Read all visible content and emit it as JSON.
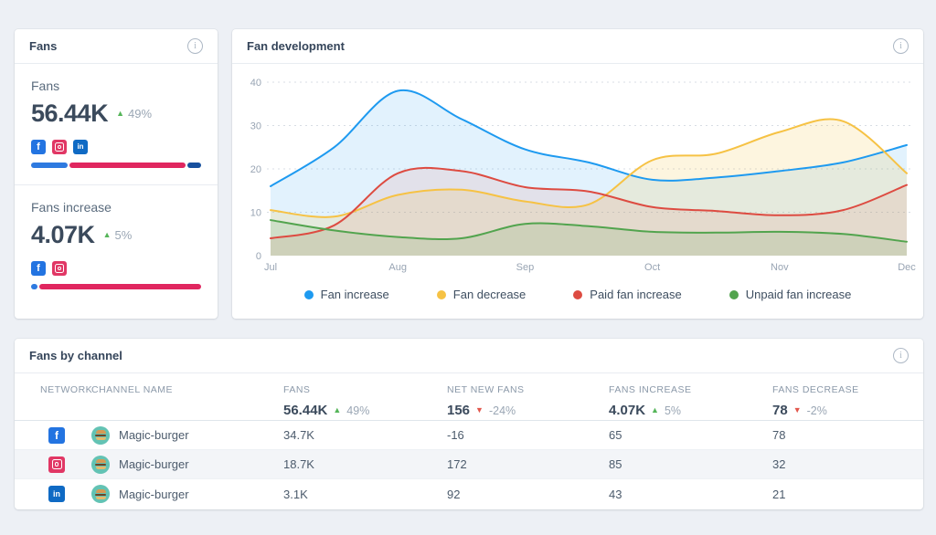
{
  "fans_card": {
    "title": "Fans",
    "sections": [
      {
        "label": "Fans",
        "value": "56.44K",
        "trend": {
          "dir": "up",
          "pct": "49%"
        },
        "networks": [
          "facebook",
          "instagram",
          "linkedin"
        ],
        "bar_segments": [
          {
            "color": "#2e7ae0",
            "pct": 22
          },
          {
            "color": "#e0265f",
            "pct": 70
          },
          {
            "color": "#17509e",
            "pct": 8
          }
        ]
      },
      {
        "label": "Fans increase",
        "value": "4.07K",
        "trend": {
          "dir": "up",
          "pct": "5%"
        },
        "networks": [
          "facebook",
          "instagram"
        ],
        "bar_segments": [
          {
            "color": "#2e7ae0",
            "pct": 4
          },
          {
            "color": "#e0265f",
            "pct": 96
          }
        ]
      }
    ]
  },
  "chart_card": {
    "title": "Fan development",
    "chart_data": {
      "type": "area",
      "title": "Fan development",
      "x_ticks": [
        "Jul",
        "Aug",
        "Sep",
        "Oct",
        "Nov",
        "Dec"
      ],
      "x_resolution": "half-month steps from Jul to Dec",
      "y_ticks": [
        0,
        10,
        20,
        30,
        40
      ],
      "ylim": [
        0,
        40
      ],
      "grid": "dotted-horizontal",
      "legend_position": "bottom",
      "series": [
        {
          "name": "Fan increase",
          "color": "#1e9af0",
          "values": [
            16,
            25,
            38,
            31.5,
            24.5,
            21.5,
            17.5,
            18,
            19.5,
            21.5,
            25.5
          ]
        },
        {
          "name": "Fan decrease",
          "color": "#f6c244",
          "values": [
            10.5,
            9,
            14,
            15.2,
            12.5,
            11.8,
            22,
            23.5,
            28.5,
            31,
            19
          ]
        },
        {
          "name": "Paid fan increase",
          "color": "#dd4b41",
          "values": [
            4,
            7,
            19,
            19.5,
            15.8,
            14.8,
            11.2,
            10.3,
            9.3,
            10.5,
            16.3
          ]
        },
        {
          "name": "Unpaid fan increase",
          "color": "#52a44e",
          "values": [
            8.2,
            5.8,
            4.3,
            4,
            7.3,
            6.8,
            5.5,
            5.3,
            5.5,
            5,
            3.2
          ]
        }
      ]
    }
  },
  "table_card": {
    "title": "Fans by channel",
    "columns": {
      "network": "NETWORK",
      "channel": "CHANNEL NAME",
      "fans": "FANS",
      "net_new_fans": "NET NEW FANS",
      "fans_increase": "FANS INCREASE",
      "fans_decrease": "FANS DECREASE"
    },
    "summary": {
      "fans": {
        "value": "56.44K",
        "dir": "up",
        "pct": "49%"
      },
      "net_new_fans": {
        "value": "156",
        "dir": "down",
        "pct": "-24%"
      },
      "fans_increase": {
        "value": "4.07K",
        "dir": "up",
        "pct": "5%"
      },
      "fans_decrease": {
        "value": "78",
        "dir": "down",
        "pct": "-2%"
      }
    },
    "rows": [
      {
        "network": "facebook",
        "channel": "Magic-burger",
        "fans": "34.7K",
        "net_new_fans": "-16",
        "fans_increase": "65",
        "fans_decrease": "78"
      },
      {
        "network": "instagram",
        "channel": "Magic-burger",
        "fans": "18.7K",
        "net_new_fans": "172",
        "fans_increase": "85",
        "fans_decrease": "32"
      },
      {
        "network": "linkedin",
        "channel": "Magic-burger",
        "fans": "3.1K",
        "net_new_fans": "92",
        "fans_increase": "43",
        "fans_decrease": "21"
      }
    ]
  },
  "colors": {
    "trend_up": "#55b559",
    "trend_down": "#e2574c",
    "facebook": "#2374e1",
    "instagram": "#e13765",
    "linkedin": "#0f6ac4",
    "avatar_bg": "#63c3b4"
  },
  "icons": {
    "info": "info-circle-i",
    "facebook": "facebook-f",
    "instagram": "instagram-camera",
    "linkedin": "linkedin-in",
    "trend_up": "triangle-up",
    "trend_down": "triangle-down"
  }
}
